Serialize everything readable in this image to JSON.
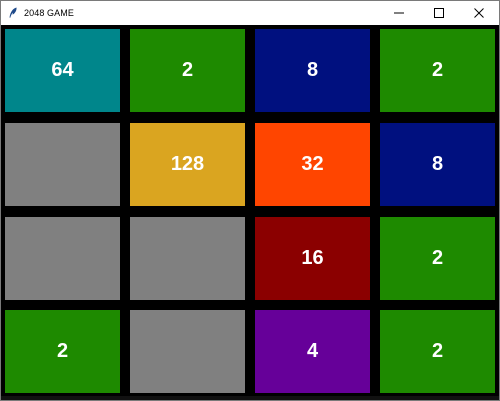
{
  "window": {
    "title": "2048 GAME"
  },
  "icons": {
    "app": "feather-icon",
    "minimize": "minimize-icon",
    "maximize": "maximize-icon",
    "close": "close-icon"
  },
  "colors": {
    "board_bg": "#000000",
    "empty": "#808080",
    "2": "#1e8a00",
    "4": "#660099",
    "8": "#00107f",
    "16": "#8b0000",
    "32": "#ff4500",
    "64": "#00868b",
    "128": "#daa520"
  },
  "board": [
    [
      "64",
      "2",
      "8",
      "2"
    ],
    [
      "",
      "128",
      "32",
      "8"
    ],
    [
      "",
      "",
      "16",
      "2"
    ],
    [
      "2",
      "",
      "4",
      "2"
    ]
  ]
}
